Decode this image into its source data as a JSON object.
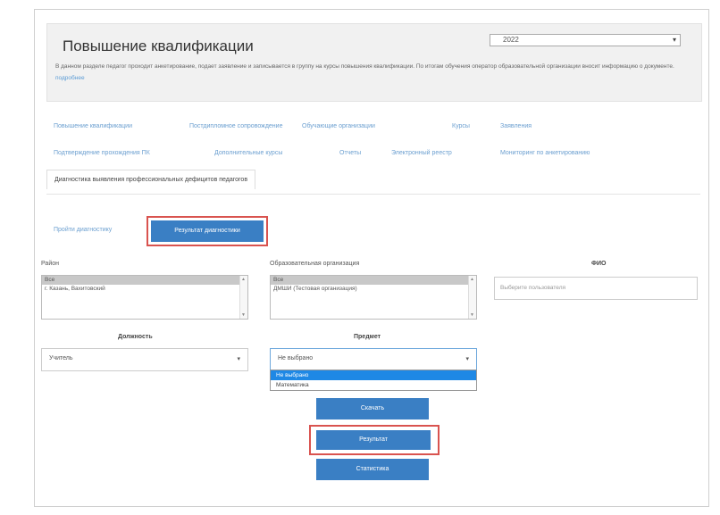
{
  "header": {
    "title": "Повышение квалификации",
    "year_value": "2022",
    "description": "В данном разделе педагог проходит анкетирование, подает заявление и записывается в группу на курсы повышения квалификации. По итогам обучения оператор образовательной организации вносит информацию о документе.",
    "description_link": "подробнее"
  },
  "tabs": [
    "Повышение квалификации",
    "Постдипломное сопровождение",
    "Обучающие организации",
    "Курсы",
    "Заявления",
    "Подтверждение прохождения ПК",
    "Дополнительные курсы",
    "Отчеты",
    "Электронный реестр",
    "Мониторинг по анкетированию",
    "Диагностика выявления профессиональных дефицитов педагогов"
  ],
  "subtabs": {
    "pass": "Пройти диагностику",
    "results": "Результат диагностики"
  },
  "filters": {
    "district_label": "Район",
    "district_options": [
      "Все",
      "г. Казань, Вахитовский"
    ],
    "org_label": "Образовательная организация",
    "org_options": [
      "Все",
      "ДМШИ (Тестовая организация)"
    ],
    "fio_label": "ФИО",
    "fio_placeholder": "Выберите пользователя",
    "position_label": "Должность",
    "position_value": "Учитель",
    "subject_label": "Предмет",
    "subject_value": "Не выбрано",
    "subject_options": [
      "Не выбрано",
      "Математика"
    ]
  },
  "buttons": {
    "download": "Скачать",
    "results": "Результат",
    "statistics": "Статистика"
  },
  "icons": {
    "chevron": "chevron-down-icon",
    "scroll_up": "scroll-up-icon",
    "scroll_down": "scroll-down-icon"
  },
  "colors": {
    "accent": "#3a7fc4",
    "highlight_border": "#d9534f",
    "link": "#6b9fd0",
    "selected_option": "#1e88e5"
  }
}
